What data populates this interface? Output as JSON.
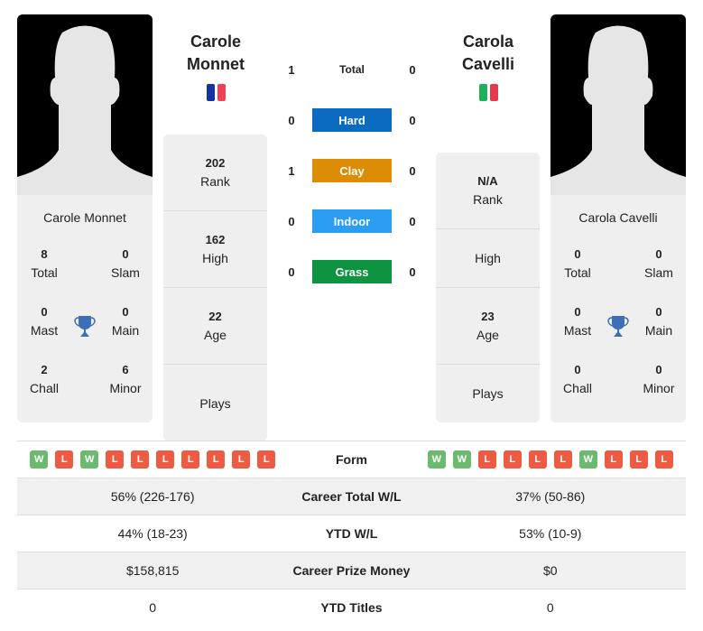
{
  "player1": {
    "name_line1": "Carole",
    "name_line2": "Monnet",
    "full_name": "Carole Monnet",
    "flag": "france-flag",
    "flag_colors": [
      "#1434a4",
      "#ffffff",
      "#ef4155"
    ],
    "titles": {
      "total": {
        "value": "8",
        "label": "Total"
      },
      "slam": {
        "value": "0",
        "label": "Slam"
      },
      "mast": {
        "value": "0",
        "label": "Mast"
      },
      "main": {
        "value": "0",
        "label": "Main"
      },
      "chall": {
        "value": "2",
        "label": "Chall"
      },
      "minor": {
        "value": "6",
        "label": "Minor"
      }
    },
    "stats": {
      "rank": {
        "value": "202",
        "label": "Rank"
      },
      "high": {
        "value": "162",
        "label": "High"
      },
      "age": {
        "value": "22",
        "label": "Age"
      },
      "plays": {
        "value": "",
        "label": "Plays"
      }
    },
    "form": [
      "W",
      "L",
      "W",
      "L",
      "L",
      "L",
      "L",
      "L",
      "L",
      "L"
    ]
  },
  "player2": {
    "name_line1": "Carola",
    "name_line2": "Cavelli",
    "full_name": "Carola Cavelli",
    "flag": "italy-flag",
    "flag_colors": [
      "#1eb15a",
      "#ffffff",
      "#e8394a"
    ],
    "titles": {
      "total": {
        "value": "0",
        "label": "Total"
      },
      "slam": {
        "value": "0",
        "label": "Slam"
      },
      "mast": {
        "value": "0",
        "label": "Mast"
      },
      "main": {
        "value": "0",
        "label": "Main"
      },
      "chall": {
        "value": "0",
        "label": "Chall"
      },
      "minor": {
        "value": "0",
        "label": "Minor"
      }
    },
    "stats": {
      "rank": {
        "value": "N/A",
        "label": "Rank"
      },
      "high": {
        "value": "",
        "label": "High"
      },
      "age": {
        "value": "23",
        "label": "Age"
      },
      "plays": {
        "value": "",
        "label": "Plays"
      }
    },
    "form": [
      "W",
      "W",
      "L",
      "L",
      "L",
      "L",
      "W",
      "L",
      "L",
      "L"
    ]
  },
  "h2h": [
    {
      "label": "Total",
      "p1": "1",
      "p2": "0",
      "color": ""
    },
    {
      "label": "Hard",
      "p1": "0",
      "p2": "0",
      "color": "#0b6bc1"
    },
    {
      "label": "Clay",
      "p1": "1",
      "p2": "0",
      "color": "#dc8c05"
    },
    {
      "label": "Indoor",
      "p1": "0",
      "p2": "0",
      "color": "#2b9ef4"
    },
    {
      "label": "Grass",
      "p1": "0",
      "p2": "0",
      "color": "#0e9340"
    }
  ],
  "comparison": {
    "form_label": "Form",
    "rows": [
      {
        "label": "Career Total W/L",
        "p1": "56% (226-176)",
        "p2": "37% (50-86)"
      },
      {
        "label": "YTD W/L",
        "p1": "44% (18-23)",
        "p2": "53% (10-9)"
      },
      {
        "label": "Career Prize Money",
        "p1": "$158,815",
        "p2": "$0"
      },
      {
        "label": "YTD Titles",
        "p1": "0",
        "p2": "0"
      }
    ]
  },
  "colors": {
    "win": "#6bba6f",
    "loss": "#ee5b42",
    "trophy": "#3d6fb6"
  }
}
